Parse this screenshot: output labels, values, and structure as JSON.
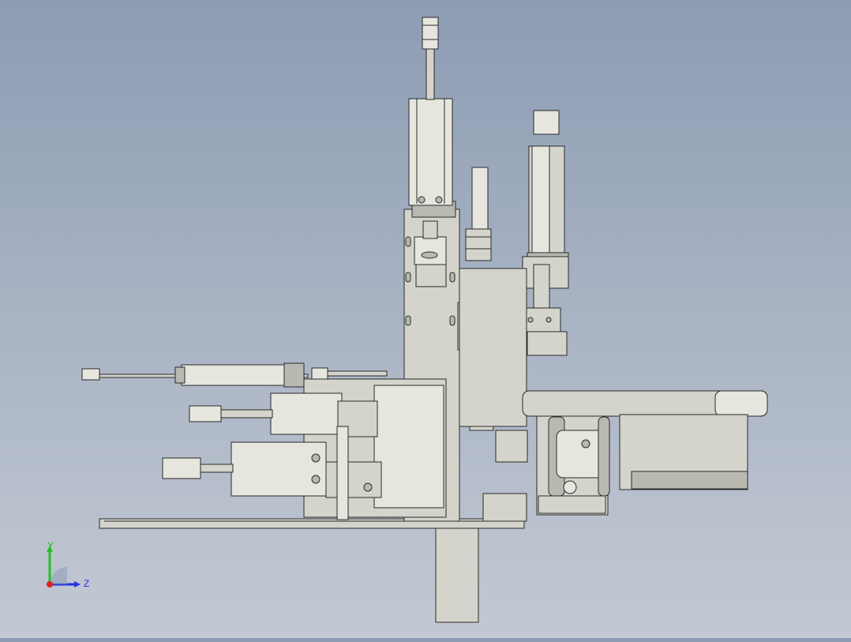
{
  "viewport": {
    "background_top": "#8c9cb3",
    "background_bottom": "#c3c9d3",
    "part_fill": "#d4d4cc",
    "edge_color": "#2a2a2a"
  },
  "triad": {
    "y_label": "Y",
    "z_label": "Z",
    "y_color": "#22c322",
    "z_color": "#2233dd",
    "x_color": "#dd2222"
  }
}
